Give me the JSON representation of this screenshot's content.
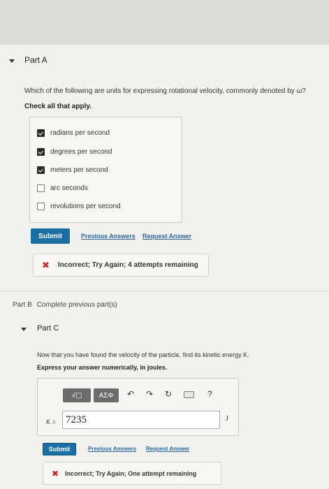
{
  "partA": {
    "title": "Part A",
    "question": "Which of the following are units for expressing rotational velocity, commonly denoted by ω?",
    "instruction": "Check all that apply.",
    "choices": [
      {
        "label": "radians per second",
        "checked": true
      },
      {
        "label": "degrees per second",
        "checked": true
      },
      {
        "label": "meters per second",
        "checked": true
      },
      {
        "label": "arc seconds",
        "checked": false
      },
      {
        "label": "revolutions per second",
        "checked": false
      }
    ],
    "submit_label": "Submit",
    "previous_answers_label": "Previous Answers",
    "request_answer_label": "Request Answer",
    "feedback": "Incorrect; Try Again; 4 attempts remaining"
  },
  "partB": {
    "title": "Part B",
    "status": "Complete previous part(s)"
  },
  "partC": {
    "title": "Part C",
    "question": "Now that you have found the velocity of the particle, find its kinetic energy K.",
    "instruction": "Express your answer numerically, in joules.",
    "toolbar": {
      "template_label": "√▢",
      "symbols_label": "ΑΣΦ",
      "help_label": "?"
    },
    "answer_label": "K =",
    "answer_value": "7235",
    "unit": "J",
    "submit_label": "Submit",
    "previous_answers_label": "Previous Answers",
    "request_answer_label": "Request Answer",
    "feedback": "Incorrect; Try Again; One attempt remaining"
  },
  "colors": {
    "submit": "#1a6fa3",
    "link": "#2a6aa0",
    "error": "#c0262c"
  },
  "icons": [
    "caret-down-icon",
    "checkbox-icon",
    "x-icon",
    "undo-icon",
    "redo-icon",
    "reset-icon",
    "keyboard-icon",
    "help-icon"
  ]
}
